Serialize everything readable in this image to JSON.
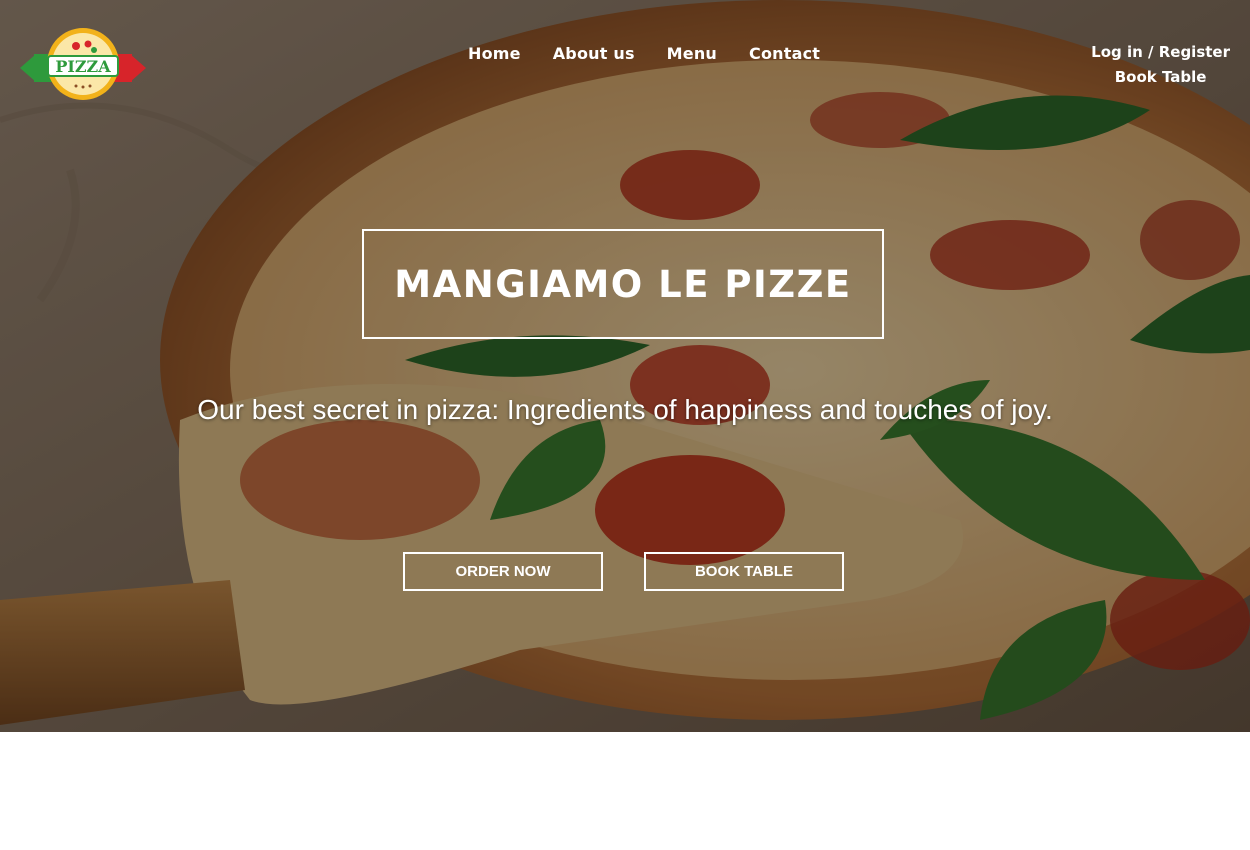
{
  "nav": {
    "items": [
      {
        "label": "Home"
      },
      {
        "label": "About us"
      },
      {
        "label": "Menu"
      },
      {
        "label": "Contact"
      }
    ]
  },
  "account": {
    "login_label": "Log in / Register",
    "book_label": "Book Table"
  },
  "logo": {
    "text": "PIZZA",
    "icon": "pizza-logo"
  },
  "hero": {
    "title": "MANGIAMO LE PIZZE",
    "tagline": "Our best secret in pizza: Ingredients of happiness and touches of joy.",
    "order_button": "ORDER NOW",
    "book_button": "BOOK TABLE"
  },
  "colors": {
    "overlay_text": "#ffffff",
    "logo_red": "#d7242a",
    "logo_green": "#2e9a3c",
    "logo_gold": "#f2b21a"
  }
}
